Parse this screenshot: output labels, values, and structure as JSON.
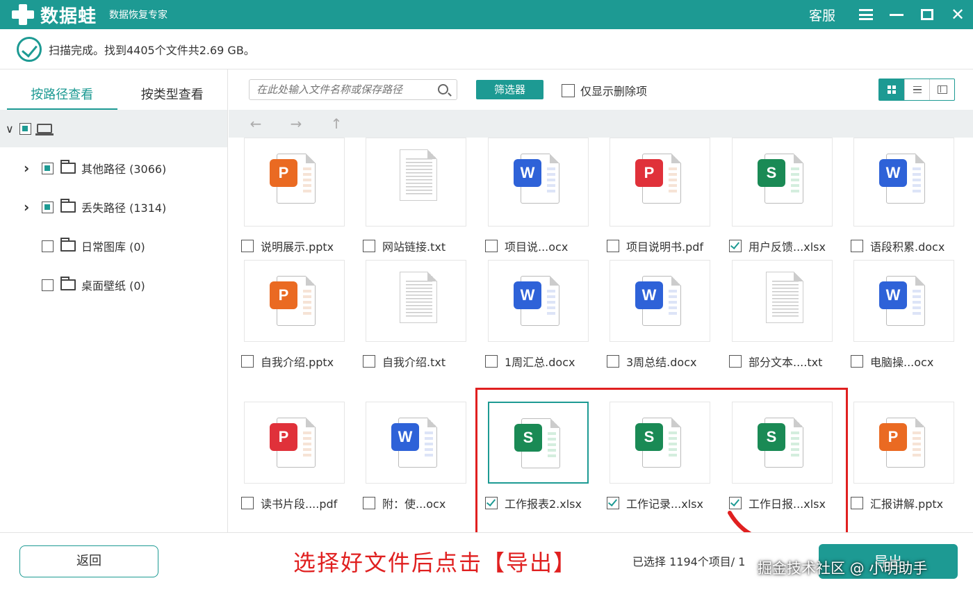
{
  "titlebar": {
    "app_name": "数据蛙",
    "app_subtitle": "数据恢复专家",
    "service_label": "客服"
  },
  "scan": {
    "status_text": "扫描完成。找到4405个文件共2.69 GB。"
  },
  "left_panel": {
    "tabs": [
      {
        "label": "按路径查看",
        "active": true
      },
      {
        "label": "按类型查看",
        "active": false
      }
    ],
    "tree": [
      {
        "label": "其他路径 (3066)",
        "expandable": true,
        "checked": "partial"
      },
      {
        "label": "丢失路径 (1314)",
        "expandable": true,
        "checked": "partial"
      },
      {
        "label": "日常图库 (0)",
        "expandable": false,
        "checked": "none"
      },
      {
        "label": "桌面壁纸 (0)",
        "expandable": false,
        "checked": "none"
      }
    ]
  },
  "toolbar": {
    "search_placeholder": "在此处输入文件名称或保存路径",
    "filter_label": "筛选器",
    "only_deleted_label": "仅显示删除项"
  },
  "files": [
    {
      "name": "说明展示.pptx",
      "type": "pptx",
      "checked": false
    },
    {
      "name": "网站链接.txt",
      "type": "txt",
      "checked": false
    },
    {
      "name": "项目说...ocx",
      "type": "docx",
      "checked": false
    },
    {
      "name": "项目说明书.pdf",
      "type": "pdf",
      "checked": false
    },
    {
      "name": "用户反馈...xlsx",
      "type": "xlsx",
      "checked": true
    },
    {
      "name": "语段积累.docx",
      "type": "docx",
      "checked": false
    },
    {
      "name": "自我介绍.pptx",
      "type": "pptx",
      "checked": false
    },
    {
      "name": "自我介绍.txt",
      "type": "txt",
      "checked": false
    },
    {
      "name": "1周汇总.docx",
      "type": "docx",
      "checked": false
    },
    {
      "name": "3周总结.docx",
      "type": "docx",
      "checked": false
    },
    {
      "name": "部分文本....txt",
      "type": "txt",
      "checked": false
    },
    {
      "name": "电脑操...ocx",
      "type": "docx",
      "checked": false
    },
    {
      "name": "读书片段....pdf",
      "type": "pdf",
      "checked": false
    },
    {
      "name": "附：使...ocx",
      "type": "docx",
      "checked": false
    },
    {
      "name": "工作报表2.xlsx",
      "type": "xlsx",
      "checked": true
    },
    {
      "name": "工作记录...xlsx",
      "type": "xlsx",
      "checked": true
    },
    {
      "name": "工作日报...xlsx",
      "type": "xlsx",
      "checked": true
    },
    {
      "name": "汇报讲解.pptx",
      "type": "pptx",
      "checked": false
    }
  ],
  "file_type_letters": {
    "pptx": "P",
    "docx": "W",
    "xlsx": "S",
    "pdf": "P"
  },
  "bottom": {
    "back_label": "返回",
    "hint": "选择好文件后点击【导出】",
    "selected_count": "已选择 1194个项目/ 1",
    "export_label": "导出",
    "watermark": "掘金技术社区 @ 小明助手"
  },
  "colors": {
    "accent": "#1d9a93",
    "highlight": "#e02020"
  }
}
